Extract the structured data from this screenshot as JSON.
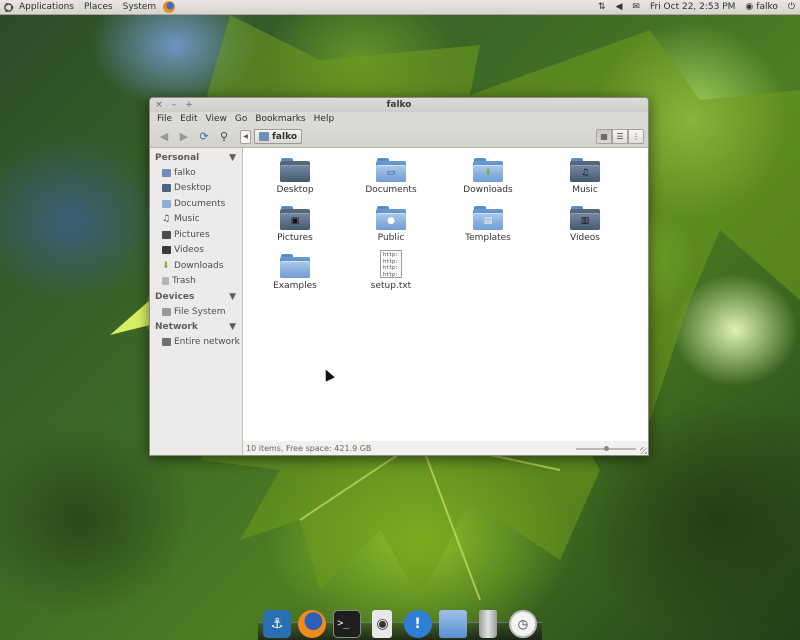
{
  "top_panel": {
    "menus": [
      "Applications",
      "Places",
      "System"
    ],
    "datetime": "Fri Oct 22,  2:53 PM",
    "user": "falko"
  },
  "window": {
    "title": "falko",
    "controls": [
      "×",
      "–",
      "+"
    ],
    "menu": [
      "File",
      "Edit",
      "View",
      "Go",
      "Bookmarks",
      "Help"
    ],
    "path": "falko",
    "sidebar": {
      "personal_header": "Personal",
      "personal_items": [
        "falko",
        "Desktop",
        "Documents",
        "Music",
        "Pictures",
        "Videos",
        "Downloads",
        "Trash"
      ],
      "devices_header": "Devices",
      "device_items": [
        "File System"
      ],
      "network_header": "Network",
      "network_items": [
        "Entire network"
      ]
    },
    "files": [
      {
        "name": "Desktop",
        "icon": "folder-desktop-icon"
      },
      {
        "name": "Documents",
        "icon": "folder-documents-icon"
      },
      {
        "name": "Downloads",
        "icon": "folder-downloads-icon"
      },
      {
        "name": "Music",
        "icon": "folder-music-icon"
      },
      {
        "name": "Pictures",
        "icon": "folder-pictures-icon"
      },
      {
        "name": "Public",
        "icon": "folder-public-icon"
      },
      {
        "name": "Templates",
        "icon": "folder-templates-icon"
      },
      {
        "name": "Videos",
        "icon": "folder-videos-icon"
      },
      {
        "name": "Examples",
        "icon": "folder-icon"
      },
      {
        "name": "setup.txt",
        "icon": "text-file-icon"
      }
    ],
    "txt_preview": [
      "http:",
      "http:",
      "http:",
      "http:"
    ],
    "status": "10 items, Free space: 421.9 GB"
  },
  "dock": [
    "anchor-icon",
    "firefox-icon",
    "terminal-icon",
    "media-player-icon",
    "notification-icon",
    "file-manager-icon",
    "trash-icon",
    "clock-icon"
  ],
  "colors": {
    "panel": "#dcdad5",
    "folder": "#6e9cd3",
    "wallpaper": "#4d7d22"
  }
}
